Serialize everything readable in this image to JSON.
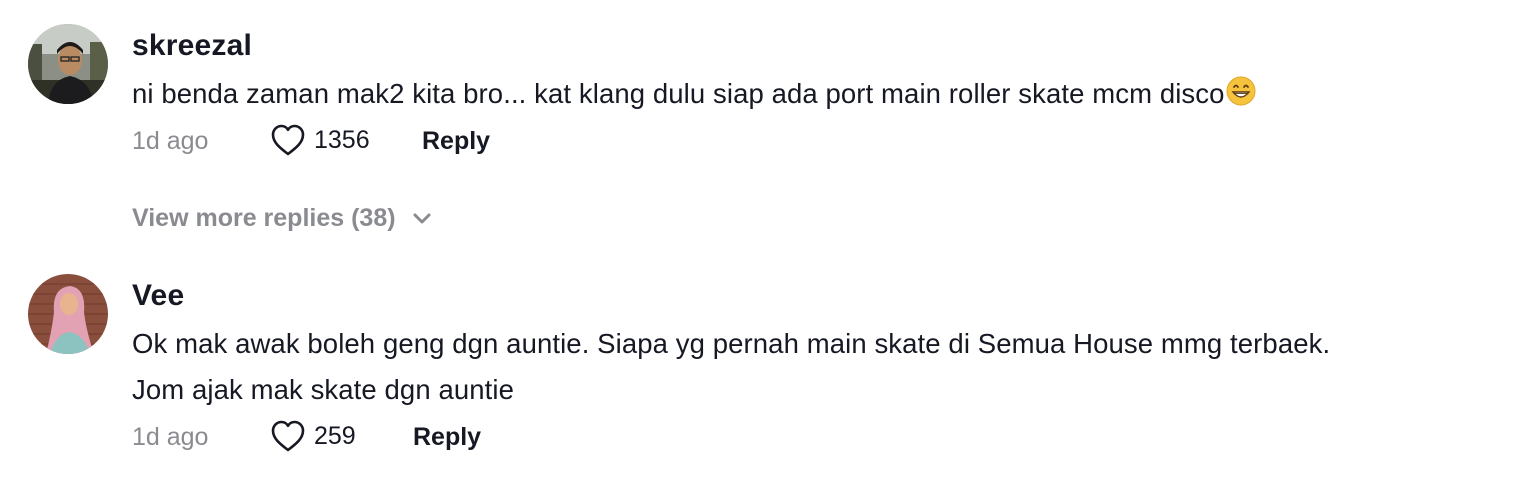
{
  "comments": [
    {
      "avatar_icon": "user-avatar-photo",
      "username": "skreezal",
      "text_lines": [
        "ni benda zaman mak2 kita bro... kat klang dulu siap ada port main roller skate mcm disco"
      ],
      "emoji_icon": "grinning-face-emoji",
      "time": "1d ago",
      "likes": "1356",
      "reply_label": "Reply"
    },
    {
      "avatar_icon": "user-avatar-photo",
      "username": "Vee",
      "text_lines": [
        "Ok mak awak boleh geng dgn auntie. Siapa yg pernah main skate di Semua House mmg terbaek.",
        "Jom ajak mak skate dgn auntie"
      ],
      "time": "1d ago",
      "likes": "259",
      "reply_label": "Reply"
    }
  ],
  "view_more_replies": "View more replies (38)",
  "colors": {
    "text": "#161823",
    "muted": "#8a8b91",
    "emoji": "#f6c33c"
  },
  "icons": {
    "like": "heart-outline-icon",
    "expand": "chevron-down-icon"
  }
}
